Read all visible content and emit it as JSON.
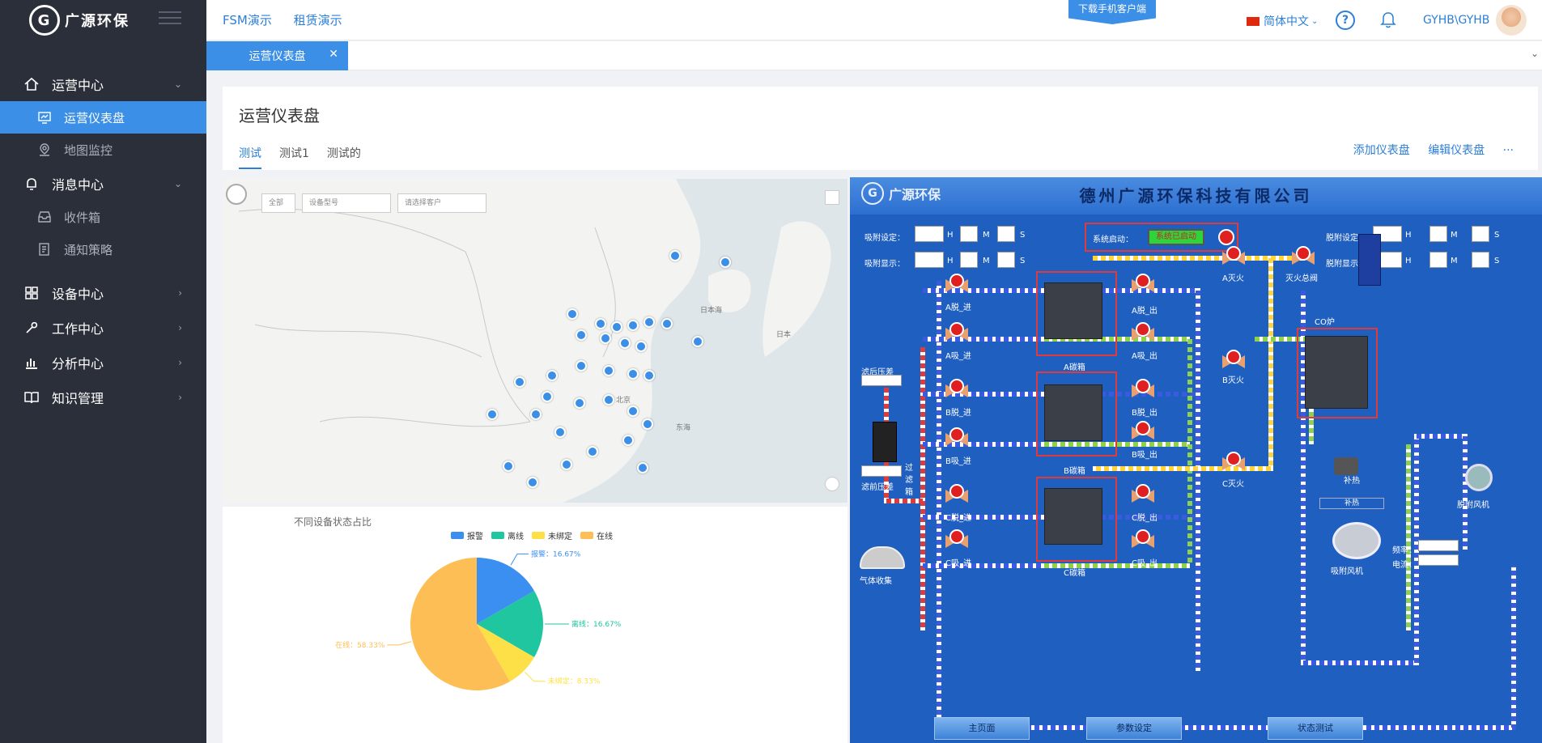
{
  "brand": {
    "name": "广源环保",
    "mark": "G"
  },
  "sidebar": {
    "items": [
      {
        "label": "运营中心",
        "icon": "home-icon",
        "expanded": true,
        "children": [
          {
            "label": "运营仪表盘",
            "icon": "dashboard-icon",
            "active": true
          },
          {
            "label": "地图监控",
            "icon": "map-pin-icon"
          }
        ]
      },
      {
        "label": "消息中心",
        "icon": "bell-icon",
        "expanded": true,
        "children": [
          {
            "label": "收件箱",
            "icon": "inbox-icon"
          },
          {
            "label": "通知策略",
            "icon": "policy-icon"
          }
        ]
      },
      {
        "label": "设备中心",
        "icon": "grid-icon"
      },
      {
        "label": "工作中心",
        "icon": "tool-icon"
      },
      {
        "label": "分析中心",
        "icon": "bar-chart-icon"
      },
      {
        "label": "知识管理",
        "icon": "book-icon"
      }
    ]
  },
  "topbar": {
    "nav": [
      "FSM演示",
      "租赁演示"
    ],
    "download": "下载手机客户端",
    "language": "简体中文",
    "user": "GYHB\\GYHB"
  },
  "tabs": {
    "page_tab": "运营仪表盘"
  },
  "page": {
    "title": "运营仪表盘",
    "subtabs": [
      "测试",
      "测试1",
      "测试的"
    ],
    "actions": [
      "添加仪表盘",
      "编辑仪表盘",
      "···"
    ]
  },
  "map": {
    "filters": [
      "全部",
      "设备型号",
      "请选择客户"
    ],
    "labels": [
      "北京",
      "日本海",
      "日本",
      "东海"
    ]
  },
  "chart_data": {
    "type": "pie",
    "title": "不同设备状态占比",
    "legend": [
      "报警",
      "离线",
      "未绑定",
      "在线"
    ],
    "slices": [
      {
        "name": "报警",
        "value": 16.67,
        "color": "#3b8ff0",
        "label": "报警：16.67%"
      },
      {
        "name": "离线",
        "value": 16.67,
        "color": "#1fc6a0",
        "label": "离线：16.67%"
      },
      {
        "name": "未绑定",
        "value": 8.33,
        "color": "#fde047",
        "label": "未绑定：8.33%"
      },
      {
        "name": "在线",
        "value": 58.33,
        "color": "#fdbf55",
        "label": "在线：58.33%"
      }
    ]
  },
  "scada": {
    "company": "德州广源环保科技有限公司",
    "logo": "广源环保",
    "adsorb_set": "吸附设定：",
    "adsorb_show": "吸附显示：",
    "desorb_set": "脱附设定：",
    "desorb_show": "脱附显示：",
    "units": [
      "H",
      "M",
      "S"
    ],
    "system_start": "系统启动：",
    "system_state": "系统已启动",
    "tanks": [
      "A碳箱",
      "B碳箱",
      "C碳箱"
    ],
    "valves": [
      "A脱_进",
      "A脱_出",
      "A吸_进",
      "A吸_出",
      "B脱_进",
      "B脱_出",
      "B吸_进",
      "B吸_出",
      "C脱_进",
      "C脱_出",
      "C吸_进",
      "C吸_出",
      "A灭火",
      "灭火总阀",
      "B灭火",
      "C灭火"
    ],
    "co_furnace": "CO炉",
    "heat": "补热",
    "desorb_fan": "脱附风机",
    "adsorb_fan": "吸附风机",
    "freq": "频率：",
    "current": "电流：",
    "filter_after": "滤后压差",
    "filter_before": "滤前压差",
    "gas_collect": "气体收集",
    "filter_box": "过滤箱",
    "buttons": [
      "主页面",
      "参数设定",
      "状态测试"
    ]
  }
}
